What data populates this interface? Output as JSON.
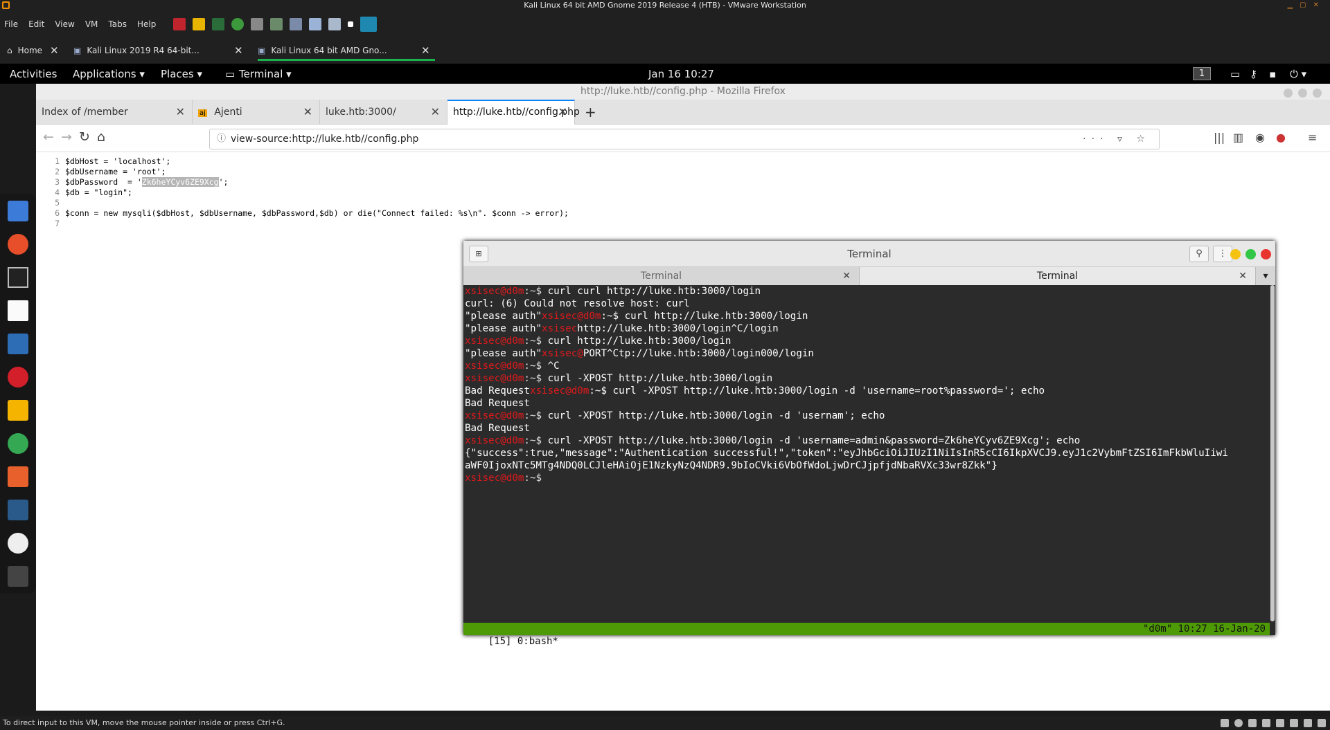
{
  "vm": {
    "title": "Kali Linux 64 bit AMD Gnome 2019 Release 4 (HTB) - VMware Workstation",
    "menu": [
      "File",
      "Edit",
      "View",
      "VM",
      "Tabs",
      "Help"
    ],
    "tabs": [
      {
        "label": "Home",
        "icon": "home-icon"
      },
      {
        "label": "Kali Linux 2019 R4 64-bit...",
        "icon": "vm-icon"
      },
      {
        "label": "Kali Linux 64 bit AMD Gno...",
        "icon": "vm-icon",
        "active": true
      }
    ],
    "status": "To direct input to this VM, move the mouse pointer inside or press Ctrl+G."
  },
  "gnome": {
    "activities": "Activities",
    "applications": "Applications ▾",
    "places": "Places ▾",
    "terminal": "Terminal ▾",
    "clock": "Jan 16  10:27",
    "workspace": "1"
  },
  "firefox": {
    "title": "http://luke.htb//config.php - Mozilla Firefox",
    "tabs": [
      {
        "label": "Index of /member"
      },
      {
        "label": "Ajenti"
      },
      {
        "label": "luke.htb:3000/"
      },
      {
        "label": "http://luke.htb//config.php",
        "active": true
      }
    ],
    "url": "view-source:http://luke.htb//config.php",
    "source_lines": [
      {
        "num": "1",
        "text": "$dbHost = 'localhost';"
      },
      {
        "num": "2",
        "text": "$dbUsername = 'root';"
      },
      {
        "num": "3",
        "pre": "$dbPassword  = '",
        "hl": "Zk6heYCyv6ZE9Xcg",
        "post": "';"
      },
      {
        "num": "4",
        "text": "$db = \"login\";"
      },
      {
        "num": "5",
        "text": ""
      },
      {
        "num": "6",
        "text": "$conn = new mysqli($dbHost, $dbUsername, $dbPassword,$db) or die(\"Connect failed: %s\\n\". $conn -> error);"
      },
      {
        "num": "7",
        "text": ""
      }
    ]
  },
  "terminal": {
    "title": "Terminal",
    "tabs": [
      "Terminal",
      "Terminal"
    ],
    "prompt_user": "xsisec@d0m",
    "prompt_sep": ":~$ ",
    "lines": [
      {
        "p": true,
        "text": "curl curl http://luke.htb:3000/login"
      },
      {
        "p": false,
        "text": "curl: (6) Could not resolve host: curl"
      },
      {
        "mix": true,
        "a": "\"please auth\"",
        "b": "xsisec@d0m",
        "c": ":~$ curl http://luke.htb:3000/login"
      },
      {
        "mix": true,
        "a": "\"please auth\"",
        "b": "xsisec",
        "c": "http://luke.htb:3000/login^C/login"
      },
      {
        "p": true,
        "text": "curl http://luke.htb:3000/login"
      },
      {
        "mix": true,
        "a": "\"please auth\"",
        "b": "xsisec@",
        "c": "PORT^Ctp://luke.htb:3000/login000/login"
      },
      {
        "p": true,
        "text": "^C"
      },
      {
        "p": true,
        "text": "curl -XPOST http://luke.htb:3000/login"
      },
      {
        "mix": true,
        "a": "Bad Request",
        "b": "xsisec@d0m",
        "c": ":~$ curl -XPOST http://luke.htb:3000/login -d 'username=root%password='; echo"
      },
      {
        "p": false,
        "text": "Bad Request"
      },
      {
        "p": true,
        "text": "curl -XPOST http://luke.htb:3000/login -d 'usernam'; echo"
      },
      {
        "p": false,
        "text": "Bad Request"
      },
      {
        "p": true,
        "text": "curl -XPOST http://luke.htb:3000/login -d 'username=admin&password=Zk6heYCyv6ZE9Xcg'; echo"
      },
      {
        "p": false,
        "text": "{\"success\":true,\"message\":\"Authentication successful!\",\"token\":\"eyJhbGciOiJIUzI1NiIsInR5cCI6IkpXVCJ9.eyJ1c2VybmFtZSI6ImFkbWluIiwi"
      },
      {
        "p": false,
        "text": "aWF0IjoxNTc5MTg4NDQ0LCJleHAiOjE1NzkyNzQ4NDR9.9bIoCVki6VbOfWdoLjwDrCJjpfjdNbaRVXc33wr8Zkk\"}"
      },
      {
        "p": true,
        "text": ""
      }
    ],
    "tmux_left": "[15] 0:bash*",
    "tmux_right": "\"d0m\" 10:27 16-Jan-20"
  }
}
